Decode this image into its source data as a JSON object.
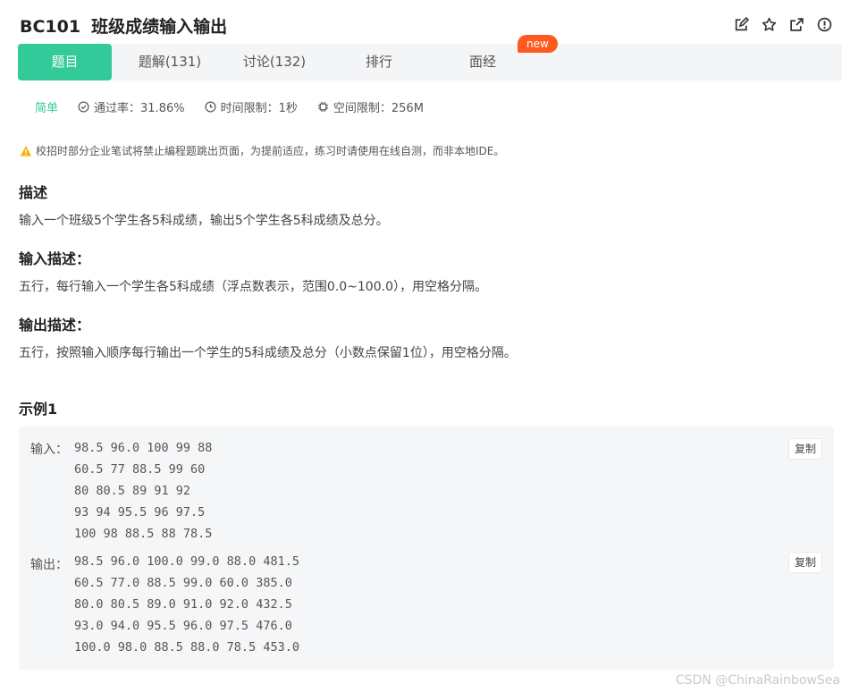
{
  "header": {
    "code": "BC101",
    "title": "班级成绩输入输出"
  },
  "tabs": [
    {
      "label": "题目"
    },
    {
      "label": "题解(131)"
    },
    {
      "label": "讨论(132)"
    },
    {
      "label": "排行"
    },
    {
      "label": "面经"
    }
  ],
  "badge_new": "new",
  "meta": {
    "difficulty": "简单",
    "pass_rate": "通过率：31.86%",
    "time_limit": "时间限制：1秒",
    "space_limit": "空间限制：256M"
  },
  "warning": "校招时部分企业笔试将禁止编程题跳出页面，为提前适应，练习时请使用在线自测，而非本地IDE。",
  "description": {
    "heading": "描述",
    "text": "输入一个班级5个学生各5科成绩，输出5个学生各5科成绩及总分。"
  },
  "input_desc": {
    "heading": "输入描述：",
    "text": "五行，每行输入一个学生各5科成绩（浮点数表示，范围0.0~100.0），用空格分隔。"
  },
  "output_desc": {
    "heading": "输出描述：",
    "text": "五行，按照输入顺序每行输出一个学生的5科成绩及总分（小数点保留1位），用空格分隔。"
  },
  "example": {
    "heading": "示例1",
    "input_label": "输入：",
    "input_lines": [
      "98.5 96.0 100 99 88",
      "60.5 77 88.5 99 60",
      "80 80.5 89 91 92",
      "93 94 95.5 96 97.5",
      "100 98 88.5 88 78.5"
    ],
    "output_label": "输出：",
    "output_lines": [
      "98.5 96.0 100.0 99.0 88.0 481.5",
      "60.5 77.0 88.5 99.0 60.0 385.0",
      "80.0 80.5 89.0 91.0 92.0 432.5",
      "93.0 94.0 95.5 96.0 97.5 476.0",
      "100.0 98.0 88.5 88.0 78.5 453.0"
    ],
    "copy_label": "复制"
  },
  "watermark": "CSDN @ChinaRainbowSea",
  "colors": {
    "accent": "#32ca99",
    "badge": "#ff5a1f",
    "warning": "#f5b400"
  }
}
